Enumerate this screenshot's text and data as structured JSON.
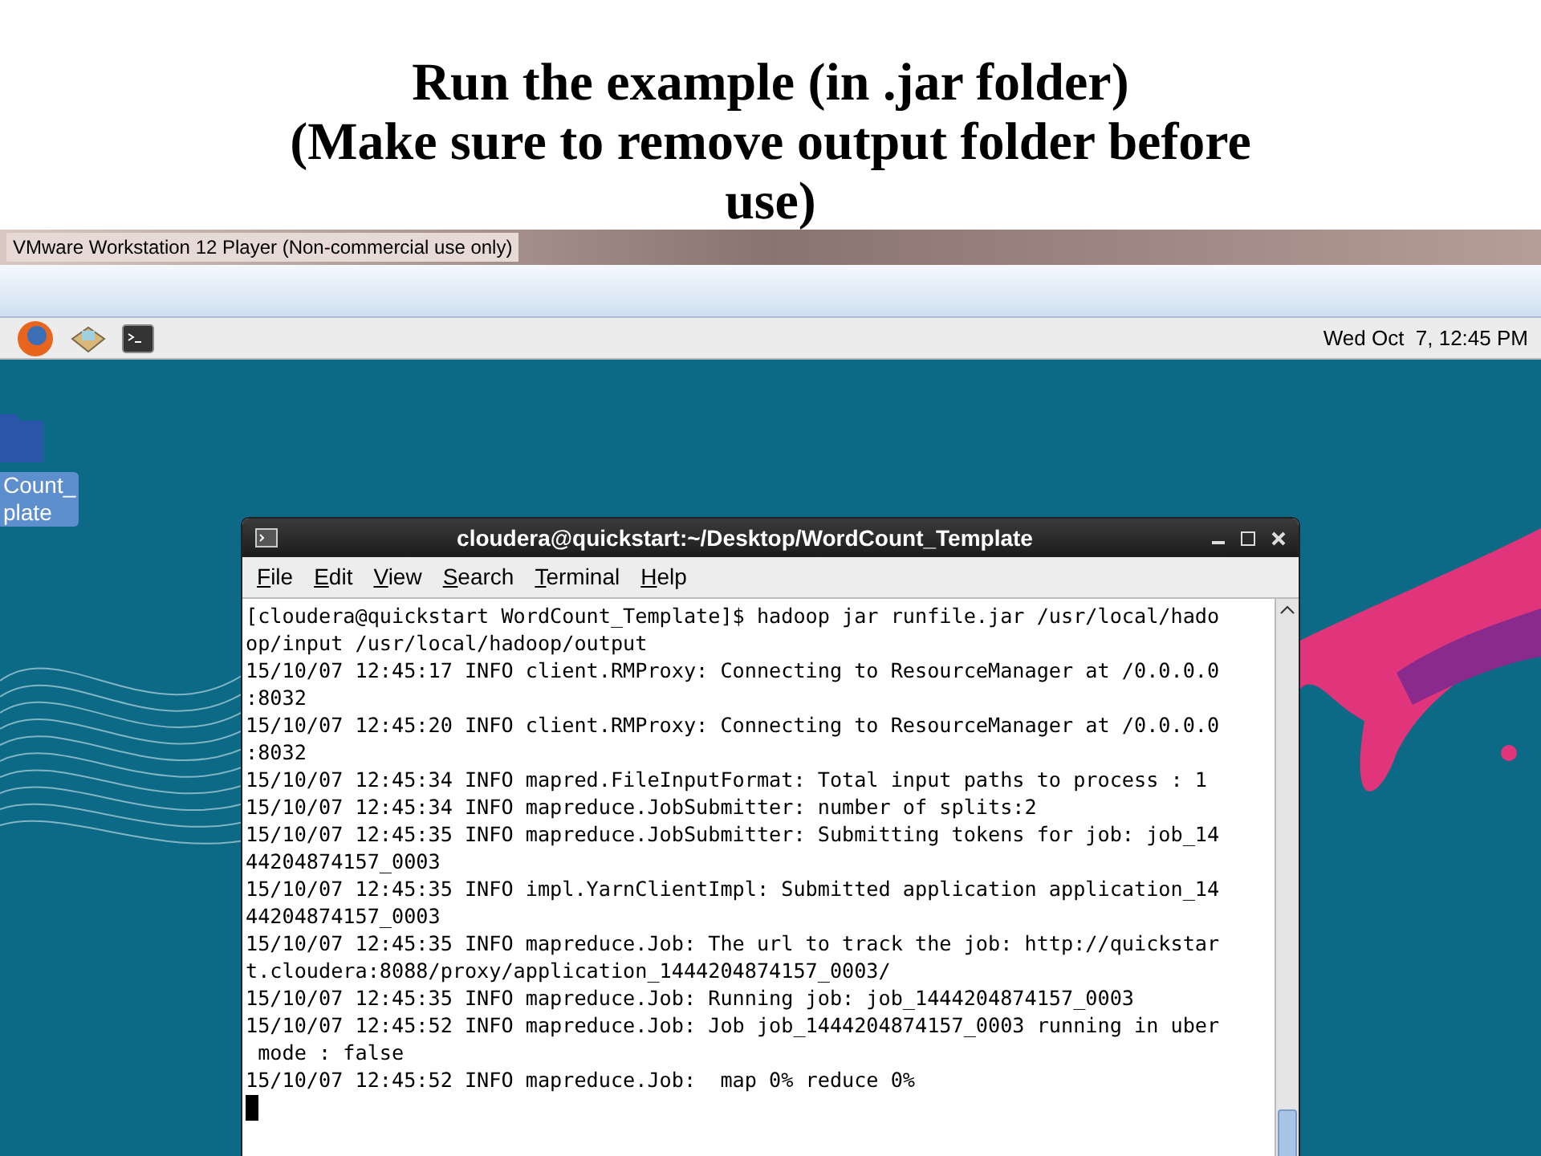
{
  "slide": {
    "title_lines": [
      "Run the example (in .jar folder)",
      "(Make sure to remove output folder before",
      "use)"
    ]
  },
  "vm_window": {
    "title": "VMware Workstation 12 Player (Non-commercial use only)"
  },
  "panel": {
    "clock": "Wed Oct  7, 12:45 PM"
  },
  "desktop": {
    "icon_label_lines": [
      "Count_",
      "plate"
    ]
  },
  "terminal": {
    "title": "cloudera@quickstart:~/Desktop/WordCount_Template",
    "menu": [
      "File",
      "Edit",
      "View",
      "Search",
      "Terminal",
      "Help"
    ],
    "lines": [
      "[cloudera@quickstart WordCount_Template]$ hadoop jar runfile.jar /usr/local/hado",
      "op/input /usr/local/hadoop/output",
      "15/10/07 12:45:17 INFO client.RMProxy: Connecting to ResourceManager at /0.0.0.0",
      ":8032",
      "15/10/07 12:45:20 INFO client.RMProxy: Connecting to ResourceManager at /0.0.0.0",
      ":8032",
      "15/10/07 12:45:34 INFO mapred.FileInputFormat: Total input paths to process : 1",
      "15/10/07 12:45:34 INFO mapreduce.JobSubmitter: number of splits:2",
      "15/10/07 12:45:35 INFO mapreduce.JobSubmitter: Submitting tokens for job: job_14",
      "44204874157_0003",
      "15/10/07 12:45:35 INFO impl.YarnClientImpl: Submitted application application_14",
      "44204874157_0003",
      "15/10/07 12:45:35 INFO mapreduce.Job: The url to track the job: http://quickstar",
      "t.cloudera:8088/proxy/application_1444204874157_0003/",
      "15/10/07 12:45:35 INFO mapreduce.Job: Running job: job_1444204874157_0003",
      "15/10/07 12:45:52 INFO mapreduce.Job: Job job_1444204874157_0003 running in uber",
      " mode : false",
      "15/10/07 12:45:52 INFO mapreduce.Job:  map 0% reduce 0%"
    ],
    "cursor": true
  }
}
